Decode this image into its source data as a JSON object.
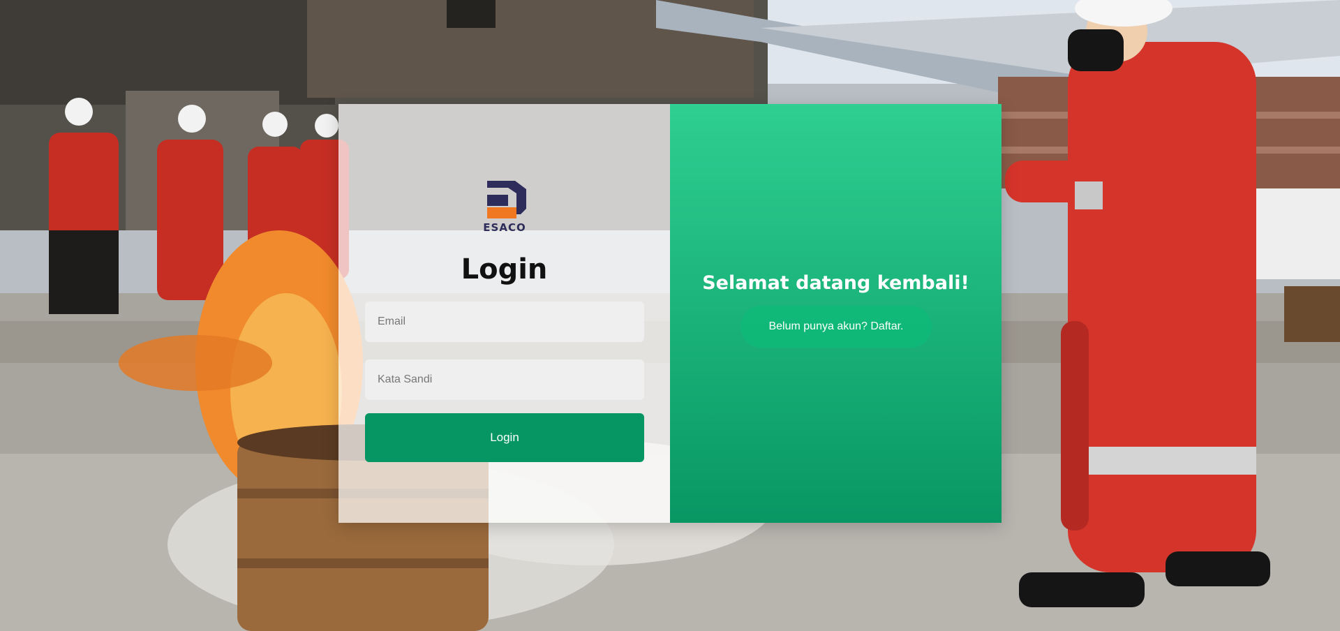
{
  "login": {
    "brand_text": "ESACO",
    "title": "Login",
    "email_placeholder": "Email",
    "password_placeholder": "Kata Sandi",
    "submit_label": "Login"
  },
  "welcome": {
    "title": "Selamat datang kembali!",
    "signup_label": "Belum punya akun? Daftar."
  },
  "colors": {
    "accent_green": "#069664",
    "gradient_top": "#2ecf90",
    "gradient_bottom": "#089764",
    "brand_navy": "#2e2c5a",
    "brand_orange": "#f07820"
  },
  "icons": {
    "logo": "esaco-logo-icon"
  }
}
